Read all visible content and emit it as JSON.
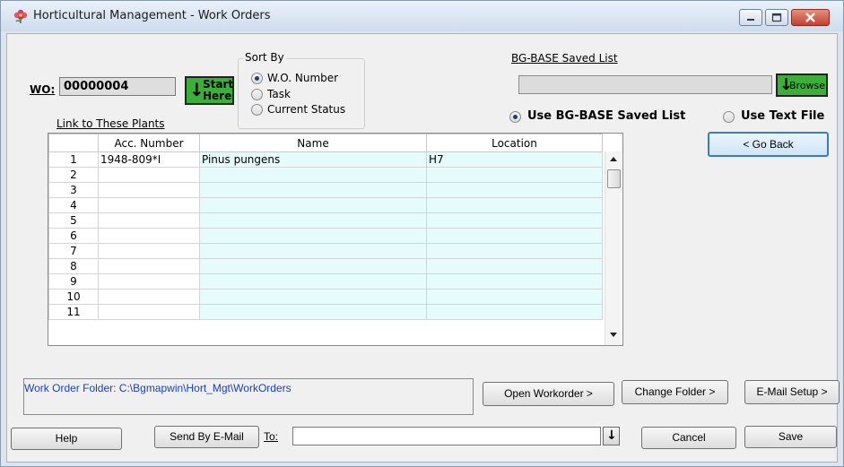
{
  "window": {
    "title": "Horticultural Management - Work Orders",
    "icon": "flower-app-icon",
    "controls": [
      "minimize-icon",
      "restore-icon",
      "close-icon"
    ],
    "close_color": "#c9463d"
  },
  "wo": {
    "label": "WO:",
    "value": "00000004"
  },
  "start_button": {
    "line1": "Start",
    "line2": "Here",
    "arrow": "↓",
    "color": "#3cae3a"
  },
  "sort_by": {
    "title": "Sort By",
    "options": [
      {
        "label": "W.O. Number",
        "selected": true
      },
      {
        "label": "Task",
        "selected": false
      },
      {
        "label": "Current Status",
        "selected": false
      }
    ]
  },
  "saved_list": {
    "label": "BG-BASE Saved List",
    "value": "",
    "browse_label": "Browse",
    "browse_arrow": "↓"
  },
  "source_options": [
    {
      "label": "Use BG-BASE Saved List",
      "selected": true
    },
    {
      "label": "Use Text File",
      "selected": false
    }
  ],
  "go_back_label": "< Go Back",
  "plants": {
    "link_label": "Link to These Plants",
    "columns": [
      "",
      "Acc. Number",
      "Name",
      "Location"
    ],
    "rows": [
      {
        "num": "1",
        "acc": "1948-809*I",
        "name": "Pinus pungens",
        "location": "H7"
      },
      {
        "num": "2",
        "acc": "",
        "name": "",
        "location": ""
      },
      {
        "num": "3",
        "acc": "",
        "name": "",
        "location": ""
      },
      {
        "num": "4",
        "acc": "",
        "name": "",
        "location": ""
      },
      {
        "num": "5",
        "acc": "",
        "name": "",
        "location": ""
      },
      {
        "num": "6",
        "acc": "",
        "name": "",
        "location": ""
      },
      {
        "num": "7",
        "acc": "",
        "name": "",
        "location": ""
      },
      {
        "num": "8",
        "acc": "",
        "name": "",
        "location": ""
      },
      {
        "num": "9",
        "acc": "",
        "name": "",
        "location": ""
      },
      {
        "num": "10",
        "acc": "",
        "name": "",
        "location": ""
      },
      {
        "num": "11",
        "acc": "",
        "name": "",
        "location": ""
      }
    ]
  },
  "folder": {
    "text": "Work Order Folder: C:\\Bgmapwin\\Hort_Mgt\\WorkOrders",
    "text_color": "#1a3fbf"
  },
  "buttons": {
    "open_workorder": "Open Workorder >",
    "change_folder": "Change Folder >",
    "email_setup": "E-Mail Setup >",
    "help": "Help",
    "send_email": "Send By E-Mail",
    "cancel": "Cancel",
    "save": "Save"
  },
  "to_field": {
    "label": "To:",
    "value": ""
  }
}
